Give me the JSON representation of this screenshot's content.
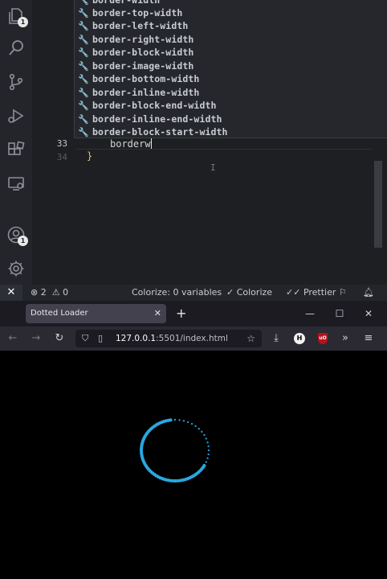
{
  "editor": {
    "suggestions": [
      "border-width",
      "border-top-width",
      "border-left-width",
      "border-right-width",
      "border-block-width",
      "border-image-width",
      "border-bottom-width",
      "border-inline-width",
      "border-block-end-width",
      "border-inline-end-width",
      "border-block-start-width"
    ],
    "line_numbers": [
      "33",
      "34"
    ],
    "typed_text": "borderw",
    "closing_brace": "}"
  },
  "activity_bar": {
    "explorer_badge": "1",
    "accounts_badge": "1"
  },
  "statusbar": {
    "errors": "2",
    "warnings": "0",
    "colorize_status": "Colorize: 0 variables",
    "colorize_button": "Colorize",
    "prettier": "Prettier"
  },
  "browser": {
    "tab_title": "Dotted Loader",
    "url_host": "127.0.0.1",
    "url_rest": ":5501/index.html",
    "ext_h_label": "H",
    "ext_ub_label": "uO"
  },
  "colors": {
    "loader_blue": "#2aa7e0",
    "vscode_bg": "#1e1f22",
    "browser_toolbar": "#2b2a33"
  }
}
